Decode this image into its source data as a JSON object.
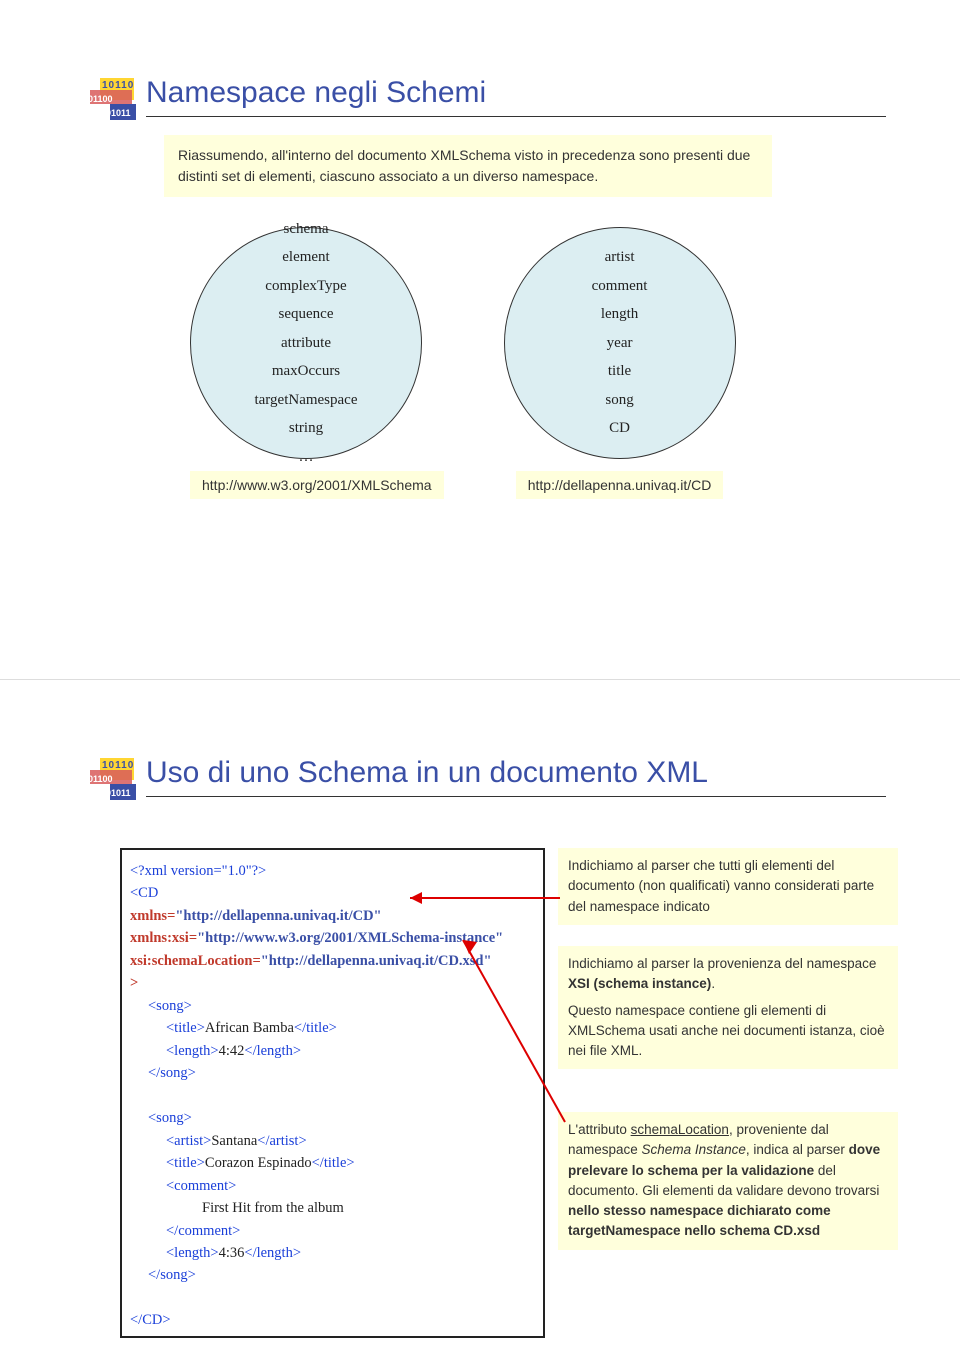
{
  "slide1": {
    "title": "Namespace negli Schemi",
    "intro": "Riassumendo, all'interno del documento XMLSchema visto in precedenza sono presenti due distinti set di elementi, ciascuno associato a un diverso namespace.",
    "circle1_items": [
      "schema",
      "element",
      "complexType",
      "sequence",
      "attribute",
      "maxOccurs",
      "targetNamespace",
      "string",
      "…"
    ],
    "circle1_url": "http://www.w3.org/2001/XMLSchema",
    "circle2_items": [
      "artist",
      "comment",
      "length",
      "year",
      "title",
      "song",
      "CD"
    ],
    "circle2_url": "http://dellapenna.univaq.it/CD"
  },
  "slide2": {
    "title": "Uso di uno Schema in un documento XML",
    "code": {
      "decl": "<?xml version=\"1.0\"?>",
      "root_open": "<CD",
      "xmlns_attr": "xmlns",
      "xmlns_val": "\"http://dellapenna.univaq.it/CD\"",
      "xmlnsxsi_attr": "xmlns:xsi",
      "xmlnsxsi_val": "\"http://www.w3.org/2001/XMLSchema-instance\"",
      "schemaloc_attr": "xsi:schemaLocation",
      "schemaloc_val": "\"http://dellapenna.univaq.it/CD.xsd\"",
      "gt": ">",
      "song_open": "<song>",
      "title_open": "<title>",
      "title1_text": "African Bamba",
      "title_close": "</title>",
      "length_open": "<length>",
      "length1_text": "4:42",
      "length_close": "</length>",
      "song_close": "</song>",
      "artist_open": "<artist>",
      "artist_text": "Santana",
      "artist_close": "</artist>",
      "title2_text": "Corazon Espinado",
      "comment_open": "<comment>",
      "comment_text": "First Hit from the album",
      "comment_close": "</comment>",
      "length2_text": "4:36",
      "root_close": "</CD>"
    },
    "note1": {
      "text": "Indichiamo al parser che tutti gli elementi del documento (non qualificati) vanno considerati parte del namespace indicato"
    },
    "note2": {
      "p1_a": "Indichiamo al parser la provenienza del namespace ",
      "p1_b": "XSI (schema instance)",
      "p1_c": ".",
      "p2": "Questo namespace contiene gli elementi di XMLSchema usati anche nei documenti istanza, cioè nei file XML."
    },
    "note3": {
      "a": "L'attributo ",
      "b": "schemaLocation",
      "c": ", proveniente dal namespace ",
      "d": "Schema Instance",
      "e": ", indica al parser ",
      "f": "dove prelevare lo schema per la validazione",
      "g": " del documento. Gli elementi da validare devono trovarsi ",
      "h": "nello stesso namespace dichiarato come targetNamespace nello schema CD.xsd"
    }
  }
}
